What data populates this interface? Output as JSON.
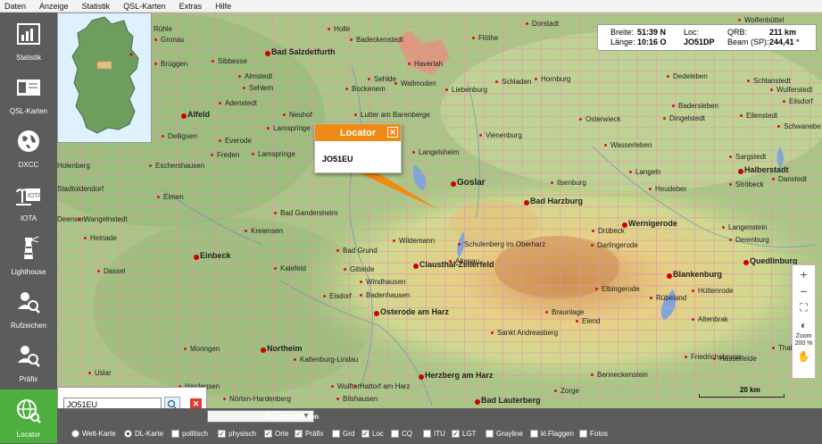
{
  "menu": [
    "Daten",
    "Anzeige",
    "Statistik",
    "QSL-Karten",
    "Extras",
    "Hilfe"
  ],
  "sidebar": [
    {
      "label": "Statistik",
      "icon": "chart-icon"
    },
    {
      "label": "QSL-Karten",
      "icon": "qsl-card-icon"
    },
    {
      "label": "DXCC",
      "icon": "globe-icon"
    },
    {
      "label": "IOTA",
      "icon": "island-icon"
    },
    {
      "label": "Lighthouse",
      "icon": "lighthouse-icon"
    },
    {
      "label": "Rufzeichen",
      "icon": "callsign-search-icon"
    },
    {
      "label": "Präfix",
      "icon": "prefix-search-icon"
    },
    {
      "label": "Locator",
      "icon": "locator-globe-icon",
      "active": true
    }
  ],
  "info": {
    "breite_label": "Breite:",
    "breite": "51:39 N",
    "laenge_label": "Länge:",
    "laenge": "10:16 O",
    "loc_label": "Loc:",
    "loc": "JO51DP",
    "qrb_label": "QRB:",
    "qrb": "211 km",
    "beam_label": "Beam (SP):",
    "beam": "244,41 °"
  },
  "popup": {
    "title": "Locator",
    "value": "JO51EU"
  },
  "search": {
    "value": "JO51EU"
  },
  "zoom": {
    "label": "Zoom",
    "value": "200 %"
  },
  "scale": {
    "label": "20 km"
  },
  "bottom": {
    "map_options": [
      {
        "label": "Welt-Karte",
        "kind": "radio",
        "checked": false
      },
      {
        "label": "DL-Karte",
        "kind": "radio",
        "checked": true
      },
      {
        "label": "politisch",
        "kind": "check",
        "checked": false
      },
      {
        "label": "physisch",
        "kind": "check",
        "checked": true
      }
    ],
    "zusatz_title": "Zusatzoptionen",
    "zusatz": [
      {
        "label": "Orte",
        "checked": true
      },
      {
        "label": "Präfix",
        "checked": true
      },
      {
        "label": "Grd",
        "checked": false
      },
      {
        "label": "Loc",
        "checked": true
      },
      {
        "label": "CQ",
        "checked": false
      },
      {
        "label": "ITU",
        "checked": false
      },
      {
        "label": "LGT",
        "checked": true
      },
      {
        "label": "Grayline",
        "checked": false
      },
      {
        "label": "kl.Flaggen",
        "checked": false
      },
      {
        "label": "Fotos",
        "checked": false
      }
    ]
  },
  "towns": [
    {
      "name": "Holle",
      "size": "small"
    },
    {
      "name": "Badeckenstedt",
      "size": "small"
    },
    {
      "name": "Dorstadt",
      "size": "small"
    },
    {
      "name": "Wolfenbüttel",
      "size": "small"
    },
    {
      "name": "Rühle",
      "size": "small"
    },
    {
      "name": "Gronau",
      "size": "small"
    },
    {
      "name": "Bad Salzdetfurth",
      "size": "mid"
    },
    {
      "name": "Flöthe",
      "size": "small"
    },
    {
      "name": "Schöppenstedt",
      "size": "small"
    },
    {
      "name": "Brüggen",
      "size": "small"
    },
    {
      "name": "Sibbesse",
      "size": "small"
    },
    {
      "name": "Haverlah",
      "size": "small"
    },
    {
      "name": "Almstedt",
      "size": "small"
    },
    {
      "name": "Sehlde",
      "size": "small"
    },
    {
      "name": "Schladen",
      "size": "small"
    },
    {
      "name": "Hornburg",
      "size": "small"
    },
    {
      "name": "Dedeleben",
      "size": "small"
    },
    {
      "name": "Schlanstedt",
      "size": "small"
    },
    {
      "name": "Sehlem",
      "size": "small"
    },
    {
      "name": "Bockenem",
      "size": "small"
    },
    {
      "name": "Wallmoden",
      "size": "small"
    },
    {
      "name": "Liebenburg",
      "size": "small"
    },
    {
      "name": "Wulferstedt",
      "size": "small"
    },
    {
      "name": "Adenstedt",
      "size": "small"
    },
    {
      "name": "Badersleben",
      "size": "small"
    },
    {
      "name": "Eilsdorf",
      "size": "small"
    },
    {
      "name": "Alfeld",
      "size": "mid"
    },
    {
      "name": "Neuhof",
      "size": "small"
    },
    {
      "name": "Lutter am Barenberge",
      "size": "small"
    },
    {
      "name": "Osterwieck",
      "size": "small"
    },
    {
      "name": "Dingelstedt",
      "size": "small"
    },
    {
      "name": "Eilenstedt",
      "size": "small"
    },
    {
      "name": "Lamspringe",
      "size": "small"
    },
    {
      "name": "Schwanebe",
      "size": "small"
    },
    {
      "name": "Delligsen",
      "size": "small"
    },
    {
      "name": "Vienenburg",
      "size": "small"
    },
    {
      "name": "Everode",
      "size": "small"
    },
    {
      "name": "Langelsheim",
      "size": "small"
    },
    {
      "name": "Wasserleben",
      "size": "small"
    },
    {
      "name": "Freden",
      "size": "small"
    },
    {
      "name": "Lamspringe",
      "size": "small"
    },
    {
      "name": "Sargstedt",
      "size": "small"
    },
    {
      "name": "Eschershausen",
      "size": "small"
    },
    {
      "name": "Langeln",
      "size": "small"
    },
    {
      "name": "Halberstadt",
      "size": "mid"
    },
    {
      "name": "Holenberg",
      "size": "small"
    },
    {
      "name": "Goslar",
      "size": "big"
    },
    {
      "name": "Ilsenburg",
      "size": "small"
    },
    {
      "name": "Heudeber",
      "size": "small"
    },
    {
      "name": "Danstedt",
      "size": "small"
    },
    {
      "name": "Stadtoldendorf",
      "size": "small"
    },
    {
      "name": "Eimen",
      "size": "small"
    },
    {
      "name": "Bad Harzburg",
      "size": "mid"
    },
    {
      "name": "Ströbeck",
      "size": "small"
    },
    {
      "name": "Deensen",
      "size": "small"
    },
    {
      "name": "Wangelnstedt",
      "size": "small"
    },
    {
      "name": "Bad Gandersheim",
      "size": "small"
    },
    {
      "name": "Langenstein",
      "size": "small"
    },
    {
      "name": "Heinade",
      "size": "small"
    },
    {
      "name": "Kreiensen",
      "size": "small"
    },
    {
      "name": "Wildemann",
      "size": "small"
    },
    {
      "name": "Schulenberg im Oberharz",
      "size": "small"
    },
    {
      "name": "Drübeck",
      "size": "small"
    },
    {
      "name": "Wernigerode",
      "size": "mid"
    },
    {
      "name": "Einbeck",
      "size": "mid"
    },
    {
      "name": "Bad Grund",
      "size": "small"
    },
    {
      "name": "Clausthal-Zellerfeld",
      "size": "mid"
    },
    {
      "name": "Altenau",
      "size": "small"
    },
    {
      "name": "Darlingerode",
      "size": "small"
    },
    {
      "name": "Derenburg",
      "size": "small"
    },
    {
      "name": "Dassel",
      "size": "small"
    },
    {
      "name": "Kalefeld",
      "size": "small"
    },
    {
      "name": "Gittelde",
      "size": "small"
    },
    {
      "name": "Blankenburg",
      "size": "mid"
    },
    {
      "name": "Quedlinburg",
      "size": "mid"
    },
    {
      "name": "Windhausen",
      "size": "small"
    },
    {
      "name": "Elbingerode",
      "size": "small"
    },
    {
      "name": "Hüttenrode",
      "size": "small"
    },
    {
      "name": "Eisdorf",
      "size": "small"
    },
    {
      "name": "Badenhausen",
      "size": "small"
    },
    {
      "name": "Rübeland",
      "size": "small"
    },
    {
      "name": "Osterode am Harz",
      "size": "mid"
    },
    {
      "name": "Braunlage",
      "size": "small"
    },
    {
      "name": "Elend",
      "size": "small"
    },
    {
      "name": "Altenbrak",
      "size": "small"
    },
    {
      "name": "Sankt Andreasberg",
      "size": "small"
    },
    {
      "name": "Thale",
      "size": "small"
    },
    {
      "name": "Moringen",
      "size": "small"
    },
    {
      "name": "Northeim",
      "size": "mid"
    },
    {
      "name": "Katlenburg-Lindau",
      "size": "small"
    },
    {
      "name": "Friedrichsbrunn",
      "size": "small"
    },
    {
      "name": "Hasselfelde",
      "size": "small"
    },
    {
      "name": "Uslar",
      "size": "small"
    },
    {
      "name": "Herzberg am Harz",
      "size": "mid"
    },
    {
      "name": "Benneckenstein",
      "size": "small"
    },
    {
      "name": "Hardegsen",
      "size": "small"
    },
    {
      "name": "Wulften",
      "size": "small"
    },
    {
      "name": "Hattorf am Harz",
      "size": "small"
    },
    {
      "name": "Zorge",
      "size": "small"
    },
    {
      "name": "Nörten-Hardenberg",
      "size": "small"
    },
    {
      "name": "Bilshausen",
      "size": "small"
    },
    {
      "name": "Bad Lauterberg",
      "size": "mid"
    },
    {
      "name": "Breitenstein",
      "size": "small"
    },
    {
      "name": "Straßberg",
      "size": "small"
    },
    {
      "name": "Gieboldehausen",
      "size": "small"
    }
  ]
}
